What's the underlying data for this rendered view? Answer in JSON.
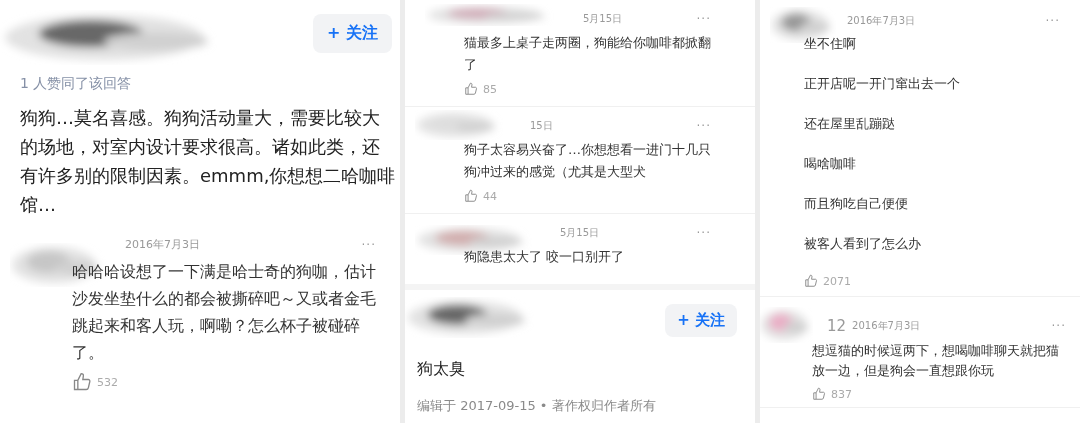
{
  "panels": [
    {
      "kind": "answer",
      "follow_button": "+ 关注",
      "upvote_note": "1 人赞同了该回答",
      "body": "狗狗…莫名喜感。狗狗活动量大，需要比较大的场地，对室内设计要求很高。诸如此类，还有许多别的限制因素。emmm,你想想二哈咖啡馆…",
      "comments": [
        {
          "date": "2016年7月3日",
          "more": "···",
          "paragraphs": [
            "哈哈哈设想了一下满是哈士奇的狗咖，估计沙发坐垫什么的都会被撕碎吧～又或者金毛跳起来和客人玩，啊嘞？怎么杯子被碰碎了。"
          ],
          "likes": "532"
        }
      ]
    },
    {
      "kind": "thread",
      "comments": [
        {
          "date": "5月15日",
          "more": "···",
          "paragraphs": [
            "猫最多上桌子走两圈，狗能给你咖啡都掀翻了"
          ],
          "likes": "85"
        },
        {
          "date": "15日",
          "more": "···",
          "paragraphs": [
            "狗子太容易兴奋了…你想想看一进门十几只狗冲过来的感觉（尤其是大型犬"
          ],
          "likes": "44"
        },
        {
          "date": "5月15日",
          "more": "···",
          "paragraphs": [
            "狗隐患太大了 咬一口别开了"
          ]
        }
      ],
      "answer": {
        "follow_button": "+ 关注",
        "body": "狗太臭",
        "footer": "编辑于 2017-09-15 • 著作权归作者所有"
      }
    },
    {
      "kind": "thread",
      "comments": [
        {
          "date": "2016年7月3日",
          "more": "···",
          "paragraphs": [
            "坐不住啊",
            "正开店呢一开门窜出去一个",
            "还在屋里乱蹦跶",
            "喝啥咖啡",
            "而且狗吃自己便便",
            "被客人看到了怎么办"
          ],
          "likes": "2071"
        },
        {
          "author": "12",
          "date": "2016年7月3日",
          "more": "···",
          "paragraphs": [
            "想逗猫的时候逗两下，想喝咖啡聊天就把猫放一边，但是狗会一直想跟你玩"
          ],
          "likes": "837"
        }
      ]
    }
  ]
}
